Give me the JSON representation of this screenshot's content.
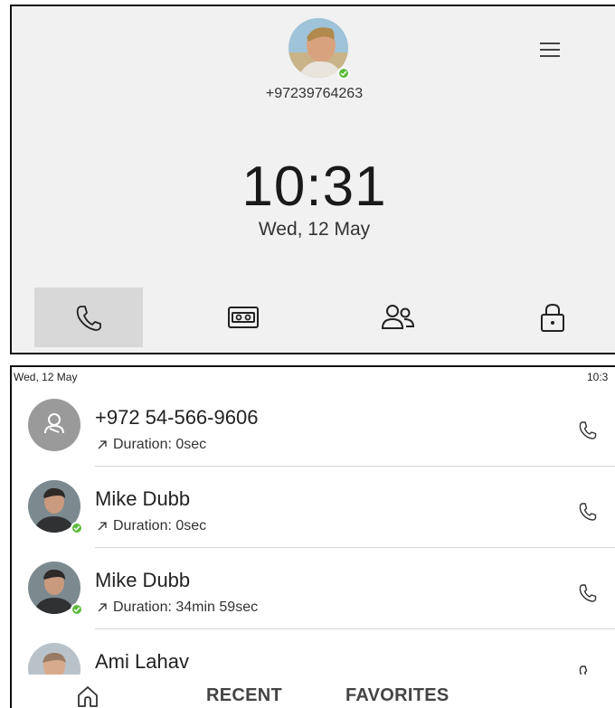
{
  "home": {
    "phone_number": "+97239764263",
    "time": "10:31",
    "date": "Wed, 12 May",
    "menu_icon": "hamburger-menu-icon",
    "nav": [
      {
        "icon": "phone-icon",
        "active": true
      },
      {
        "icon": "voicemail-icon",
        "active": false
      },
      {
        "icon": "contacts-icon",
        "active": false
      },
      {
        "icon": "lock-icon",
        "active": false
      }
    ]
  },
  "recent": {
    "status": {
      "date": "Wed, 12 May",
      "time": "10:3"
    },
    "calls": [
      {
        "name": "+972 54-566-9606",
        "duration": "Duration: 0sec",
        "avatar": "unknown-contact-icon",
        "presence": false
      },
      {
        "name": "Mike Dubb",
        "duration": "Duration: 0sec",
        "avatar": "photo",
        "presence": true
      },
      {
        "name": "Mike Dubb",
        "duration": "Duration: 34min 59sec",
        "avatar": "photo",
        "presence": true
      },
      {
        "name": "Ami Lahav",
        "duration": "",
        "avatar": "photo",
        "presence": false
      }
    ],
    "tabs": {
      "home_icon": "home-icon",
      "recent": "RECENT",
      "favorites": "FAVORITES"
    }
  },
  "colors": {
    "presence": "#5dbb3b",
    "active_nav": "#d8d8d8",
    "panel_bg": "#f1f1f1"
  }
}
